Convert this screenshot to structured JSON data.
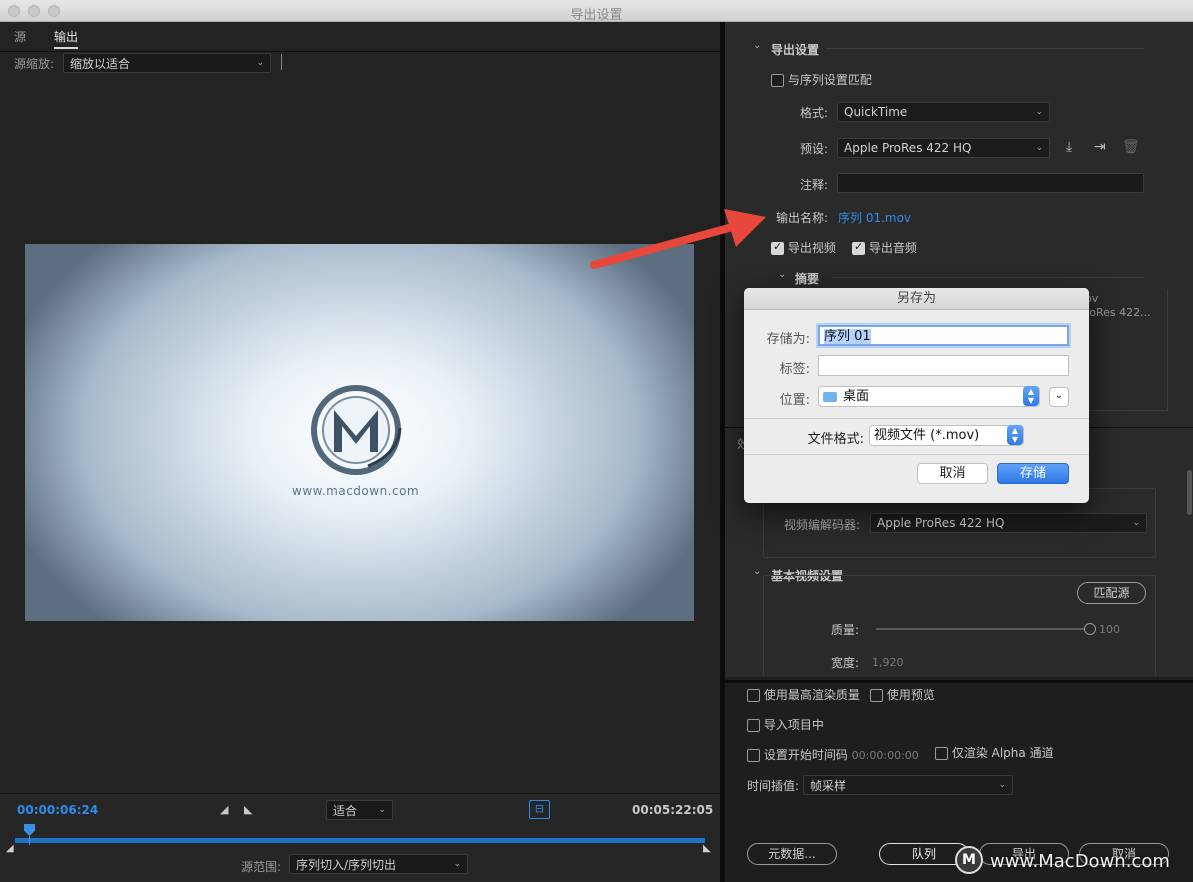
{
  "window": {
    "title": "导出设置"
  },
  "left": {
    "tabs": [
      {
        "label": "源"
      },
      {
        "label": "输出"
      }
    ],
    "source_scale_label": "源缩放:",
    "source_scale_value": "缩放以适合",
    "preview_logo_url": "www.macdown.com",
    "timecode_in": "00:00:06:24",
    "timecode_out": "00:05:22:05",
    "fit_value": "适合",
    "source_range_label": "源范围:",
    "source_range_value": "序列切入/序列切出"
  },
  "export_settings": {
    "section_title": "导出设置",
    "match_sequence": "与序列设置匹配",
    "format_label": "格式:",
    "format_value": "QuickTime",
    "preset_label": "预设:",
    "preset_value": "Apple ProRes 422 HQ",
    "comment_label": "注释:",
    "output_name_label": "输出名称:",
    "output_name_value": "序列 01.mov",
    "export_video": "导出视频",
    "export_audio": "导出音频",
    "summary_title": "摘要",
    "summary_peek_1": "ov",
    "summary_peek_2": "roRes 422..."
  },
  "right_mid": {
    "effects_peek": "效",
    "video_codec_label": "视频编解码器:",
    "video_codec_value": "Apple ProRes 422 HQ",
    "basic_video_title": "基本视频设置",
    "match_source_btn": "匹配源",
    "quality_label": "质量:",
    "quality_value": "100",
    "quality_level": 1.0,
    "width_label": "宽度:",
    "width_value": "1,920"
  },
  "right_bottom": {
    "max_render": "使用最高渲染质量",
    "use_preview": "使用预览",
    "import_project": "导入项目中",
    "set_start_tc": "设置开始时间码",
    "start_tc_value": "00:00:00:00",
    "alpha_only": "仅渲染 Alpha 通道",
    "interp_label": "时间插值:",
    "interp_value": "帧采样",
    "metadata_btn": "元数据...",
    "queue_btn": "队列",
    "export_btn": "导出",
    "cancel_btn": "取消"
  },
  "dialog": {
    "title": "另存为",
    "save_as_label": "存储为:",
    "save_as_value": "序列 01",
    "tags_label": "标签:",
    "location_label": "位置:",
    "location_value": "桌面",
    "format_label": "文件格式:",
    "format_value": "视频文件 (*.mov)",
    "cancel": "取消",
    "save": "存储"
  },
  "watermark": {
    "text": "www.MacDown.com"
  },
  "colors": {
    "accent": "#2d8ceb",
    "arrow": "#e8473c",
    "mac_blue": "#2f78e6"
  }
}
